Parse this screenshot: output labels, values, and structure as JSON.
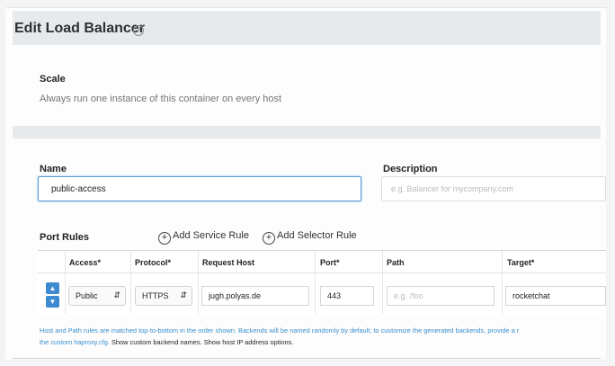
{
  "dialog": {
    "title": "Edit Load Balancer",
    "help_icon": "question-circle-icon"
  },
  "scale": {
    "label": "Scale",
    "text": "Always run one instance of this container on every host"
  },
  "form": {
    "name_label": "Name",
    "name_value": "public-access",
    "description_label": "Description",
    "description_placeholder": "e.g. Balancer for mycompany.com"
  },
  "port_rules": {
    "label": "Port Rules",
    "add_service_rule": "Add Service Rule",
    "add_selector_rule": "Add Selector Rule",
    "columns": [
      "Access*",
      "Protocol*",
      "Request Host",
      "Port*",
      "Path",
      "Target*"
    ],
    "row": {
      "access": "Public",
      "protocol": "HTTPS",
      "request_host": "jugh.polyas.de",
      "port": "443",
      "path_placeholder": "e.g. /foo",
      "target": "rocketchat"
    }
  },
  "note": {
    "line1": "Host and Path rules are matched top-to-bottom in the order shown. Backends will be named randomly by default; to customize the generated backends, provide a r",
    "line2_prefix": "the custom haproxy.cfg.",
    "show_backend": "Show custom backend names.",
    "show_ip": "Show host IP address options."
  },
  "colors": {
    "accent": "#3d8ad0",
    "focus_border": "#5b9ad8"
  }
}
